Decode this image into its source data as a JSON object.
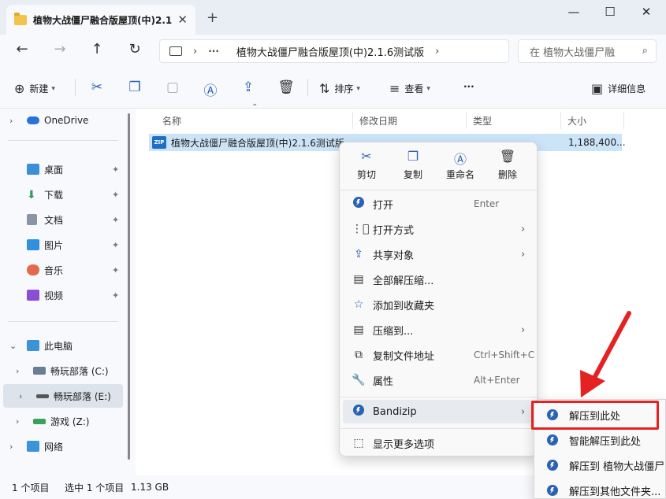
{
  "window": {
    "tab_title": "植物大战僵尸融合版屋顶(中)2.1",
    "close_tab": "✕",
    "new_tab": "+",
    "minimize": "—",
    "maximize": "☐",
    "close": "✕"
  },
  "address": {
    "path": "植物大战僵尸融合版屋顶(中)2.1.6测试版",
    "search_placeholder": "在 植物大战僵尸融"
  },
  "toolbar": {
    "new_label": "新建",
    "sort_label": "排序",
    "view_label": "查看",
    "more_label": "···",
    "details_label": "详细信息"
  },
  "sidebar": {
    "onedrive": "OneDrive",
    "desktop": "桌面",
    "downloads": "下载",
    "documents": "文档",
    "pictures": "图片",
    "music": "音乐",
    "videos": "视频",
    "this_pc": "此电脑",
    "drive_c": "畅玩部落 (C:)",
    "drive_e": "畅玩部落 (E:)",
    "drive_z": "游戏 (Z:)",
    "network": "网络"
  },
  "columns": {
    "name": "名称",
    "modified": "修改日期",
    "type": "类型",
    "size": "大小"
  },
  "file": {
    "name": "植物大战僵尸融合版屋顶(中)2.1.6测试版",
    "size": "1,188,400..."
  },
  "status": {
    "items": "1 个项目",
    "selected": "选中 1 个项目",
    "size": "1.13 GB"
  },
  "context_menu": {
    "cut": "剪切",
    "copy": "复制",
    "rename": "重命名",
    "delete": "删除",
    "open": "打开",
    "open_shortcut": "Enter",
    "open_with": "打开方式",
    "share": "共享对象",
    "extract_all": "全部解压缩...",
    "add_favorites": "添加到收藏夹",
    "compress_to": "压缩到...",
    "copy_path": "复制文件地址",
    "copy_path_shortcut": "Ctrl+Shift+C",
    "properties": "属性",
    "properties_shortcut": "Alt+Enter",
    "bandizip": "Bandizip",
    "more_options": "显示更多选项"
  },
  "submenu": {
    "extract_here": "解压到此处",
    "smart_extract": "智能解压到此处",
    "extract_to_folder": "解压到 植物大战僵尸",
    "extract_other": "解压到其他文件夹..."
  },
  "colors": {
    "accent": "#2a62b5",
    "highlight_box": "#e42222",
    "selection": "#cce4f7"
  }
}
